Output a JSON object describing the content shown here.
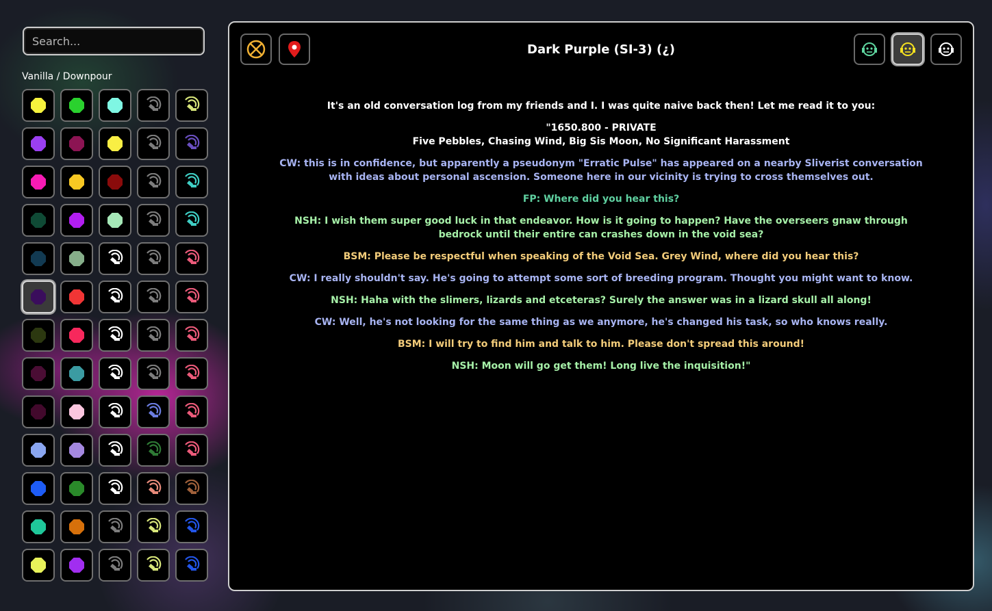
{
  "sidebar": {
    "search_placeholder": "Search...",
    "category_label": "Vanilla / Downpour",
    "grid": [
      [
        {
          "kind": "pearl",
          "color": "#f5f23d"
        },
        {
          "kind": "pearl",
          "color": "#2ad12e"
        },
        {
          "kind": "pearl",
          "color": "#7ff6e3"
        },
        {
          "kind": "broadcast",
          "color": "#7d7d7d"
        },
        {
          "kind": "broadcast",
          "color": "#d8e67a"
        }
      ],
      [
        {
          "kind": "pearl",
          "color": "#9b3ff1"
        },
        {
          "kind": "pearl",
          "color": "#8c1453"
        },
        {
          "kind": "pearl",
          "color": "#f9ee44"
        },
        {
          "kind": "broadcast",
          "color": "#7d7d7d"
        },
        {
          "kind": "broadcast",
          "color": "#6a4fc0"
        }
      ],
      [
        {
          "kind": "pearl",
          "color": "#f71bb4"
        },
        {
          "kind": "pearl",
          "color": "#f8c823"
        },
        {
          "kind": "pearl",
          "color": "#8a0b0b"
        },
        {
          "kind": "broadcast",
          "color": "#7d7d7d"
        },
        {
          "kind": "broadcast",
          "color": "#3fcfc5"
        }
      ],
      [
        {
          "kind": "pearl",
          "color": "#0f4a35"
        },
        {
          "kind": "pearl",
          "color": "#b21ef0"
        },
        {
          "kind": "pearl",
          "color": "#a6e8b8"
        },
        {
          "kind": "broadcast",
          "color": "#7d7d7d"
        },
        {
          "kind": "broadcast",
          "color": "#3fcfc5"
        }
      ],
      [
        {
          "kind": "pearl",
          "color": "#123a52"
        },
        {
          "kind": "pearl",
          "color": "#86ae8a"
        },
        {
          "kind": "broadcast",
          "color": "#ffffff"
        },
        {
          "kind": "broadcast",
          "color": "#7d7d7d"
        },
        {
          "kind": "broadcast",
          "color": "#ec5a7a"
        }
      ],
      [
        {
          "kind": "pearl",
          "color": "#3a0d5c"
        },
        {
          "kind": "pearl",
          "color": "#f03535"
        },
        {
          "kind": "broadcast",
          "color": "#ffffff"
        },
        {
          "kind": "broadcast",
          "color": "#7d7d7d"
        },
        {
          "kind": "broadcast",
          "color": "#ec5a7a"
        }
      ],
      [
        {
          "kind": "pearl",
          "color": "#2c3810"
        },
        {
          "kind": "pearl",
          "color": "#f7285c"
        },
        {
          "kind": "broadcast",
          "color": "#ffffff"
        },
        {
          "kind": "broadcast",
          "color": "#7d7d7d"
        },
        {
          "kind": "broadcast",
          "color": "#ec5a7a"
        }
      ],
      [
        {
          "kind": "pearl",
          "color": "#4a0d34"
        },
        {
          "kind": "pearl",
          "color": "#3b9ba2"
        },
        {
          "kind": "broadcast",
          "color": "#ffffff"
        },
        {
          "kind": "broadcast",
          "color": "#7d7d7d"
        },
        {
          "kind": "broadcast",
          "color": "#ec5a7a"
        }
      ],
      [
        {
          "kind": "pearl",
          "color": "#42092c"
        },
        {
          "kind": "pearl",
          "color": "#fbc6df"
        },
        {
          "kind": "broadcast",
          "color": "#ffffff"
        },
        {
          "kind": "broadcast",
          "color": "#6b7de0"
        },
        {
          "kind": "broadcast",
          "color": "#ec5a7a"
        }
      ],
      [
        {
          "kind": "pearl",
          "color": "#8aa6f0"
        },
        {
          "kind": "pearl",
          "color": "#a488e0"
        },
        {
          "kind": "broadcast",
          "color": "#ffffff"
        },
        {
          "kind": "broadcast",
          "color": "#2e7a35"
        },
        {
          "kind": "broadcast",
          "color": "#ec5a7a"
        }
      ],
      [
        {
          "kind": "pearl",
          "color": "#1e5cf5"
        },
        {
          "kind": "pearl",
          "color": "#2a8a2a"
        },
        {
          "kind": "broadcast",
          "color": "#ffffff"
        },
        {
          "kind": "broadcast",
          "color": "#e88a7a"
        },
        {
          "kind": "broadcast",
          "color": "#a0603a"
        }
      ],
      [
        {
          "kind": "pearl",
          "color": "#1fc79a"
        },
        {
          "kind": "pearl",
          "color": "#d6700b"
        },
        {
          "kind": "broadcast",
          "color": "#7d7d7d"
        },
        {
          "kind": "broadcast",
          "color": "#d8e67a"
        },
        {
          "kind": "broadcast",
          "color": "#2255e8"
        }
      ],
      [
        {
          "kind": "pearl",
          "color": "#e8f25a"
        },
        {
          "kind": "pearl",
          "color": "#a12ef0"
        },
        {
          "kind": "broadcast",
          "color": "#7d7d7d"
        },
        {
          "kind": "broadcast",
          "color": "#d8e67a"
        },
        {
          "kind": "broadcast",
          "color": "#2255e8"
        }
      ]
    ],
    "selected": {
      "row": 5,
      "col": 0
    }
  },
  "header": {
    "title": "Dark Purple (SI-3) (¿)",
    "left_buttons": [
      {
        "icon": "circled-x-icon",
        "color": "#f3b233"
      },
      {
        "icon": "map-pin-icon",
        "color": "#e21c1c"
      }
    ],
    "right_buttons": [
      {
        "icon": "iterator-mask-icon",
        "color": "#5fd6a0",
        "active": false
      },
      {
        "icon": "iterator-mask-icon",
        "color": "#f4e020",
        "active": true
      },
      {
        "icon": "iterator-mask-icon",
        "color": "#ffffff",
        "active": false
      }
    ]
  },
  "dialogue": [
    {
      "lines": [
        "It's an old conversation log from my friends and I. I was quite naive back then! Let me read it to you:"
      ],
      "color": "#ffffff"
    },
    {
      "lines": [
        "\"1650.800 - PRIVATE",
        "Five Pebbles, Chasing Wind, Big Sis Moon, No Significant Harassment"
      ],
      "color": "#ffffff"
    },
    {
      "lines": [
        "CW: this is in confidence, but apparently a pseudonym \"Erratic Pulse\" has appeared on a nearby Sliverist conversation with ideas about personal ascension. Someone here in our vicinity is trying to cross themselves out."
      ],
      "color": "#a8b4f2"
    },
    {
      "lines": [
        "FP: Where did you hear this?"
      ],
      "color": "#5fd0a0"
    },
    {
      "lines": [
        "NSH: I wish them super good luck in that endeavor. How is it going to happen? Have the overseers gnaw through bedrock until their entire can crashes down in the void sea?"
      ],
      "color": "#a6f0a8"
    },
    {
      "lines": [
        "BSM: Please be respectful when speaking of the Void Sea. Grey Wind, where did you hear this?"
      ],
      "color": "#f3cc7a"
    },
    {
      "lines": [
        "CW: I really shouldn't say. He's going to attempt some sort of breeding program. Thought you might want to know."
      ],
      "color": "#a8b4f2"
    },
    {
      "lines": [
        "NSH: Haha with the slimers, lizards and etceteras? Surely the answer was in a lizard skull all along!"
      ],
      "color": "#a6f0a8"
    },
    {
      "lines": [
        "CW: Well, he's not looking for the same thing as we anymore, he's changed his task, so who knows really."
      ],
      "color": "#a8b4f2"
    },
    {
      "lines": [
        "BSM: I will try to find him and talk to him. Please don't spread this around!"
      ],
      "color": "#f3cc7a"
    },
    {
      "lines": [
        "NSH: Moon will go get them! Long live the inquisition!\""
      ],
      "color": "#a6f0a8"
    }
  ]
}
